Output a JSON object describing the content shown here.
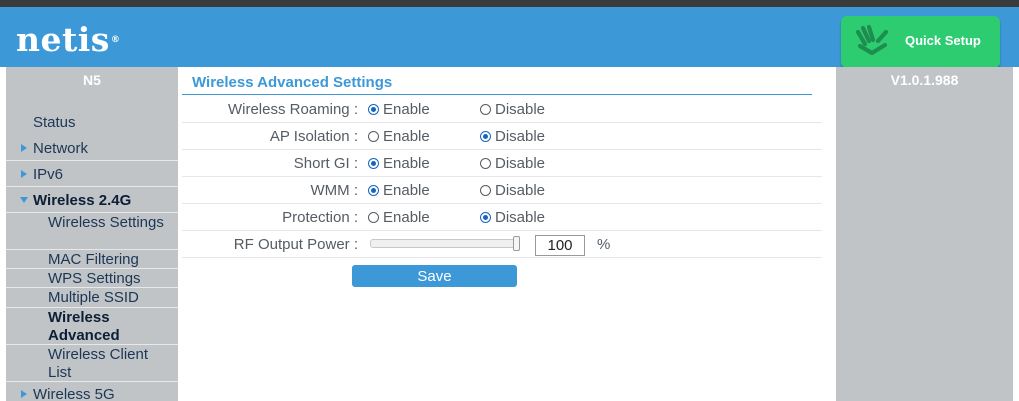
{
  "brand": {
    "logo": "netis",
    "logo_mark": "®"
  },
  "header": {
    "quick_setup": {
      "label": "Quick Setup",
      "icon": "hand-icon",
      "color": "#2ecc71"
    },
    "color": "#3d98d8"
  },
  "sidebar": {
    "model": "N5",
    "items": [
      {
        "label": "Status"
      },
      {
        "label": "Network"
      },
      {
        "label": "IPv6"
      },
      {
        "label": "Wireless 2.4G",
        "expanded": true
      },
      {
        "label": "Wireless 5G"
      }
    ],
    "subitems": [
      {
        "label": "Wireless Settings"
      },
      {
        "label": "MAC Filtering"
      },
      {
        "label": "WPS Settings"
      },
      {
        "label": "Multiple SSID"
      },
      {
        "label": "Wireless Advanced",
        "active": true
      },
      {
        "label": "Wireless Client List"
      }
    ]
  },
  "main": {
    "title": "Wireless Advanced Settings",
    "enable_label": "Enable",
    "disable_label": "Disable",
    "settings": [
      {
        "label": "Wireless Roaming :",
        "value": "Enable"
      },
      {
        "label": "AP Isolation :",
        "value": "Disable"
      },
      {
        "label": "Short GI :",
        "value": "Enable"
      },
      {
        "label": "WMM :",
        "value": "Enable"
      },
      {
        "label": "Protection :",
        "value": "Disable"
      }
    ],
    "rf_output_power": {
      "label": "RF Output Power :",
      "value": "100",
      "unit": "%",
      "slider_fraction": 1.0
    },
    "save_label": "Save"
  },
  "right_panel": {
    "version": "V1.0.1.988"
  }
}
